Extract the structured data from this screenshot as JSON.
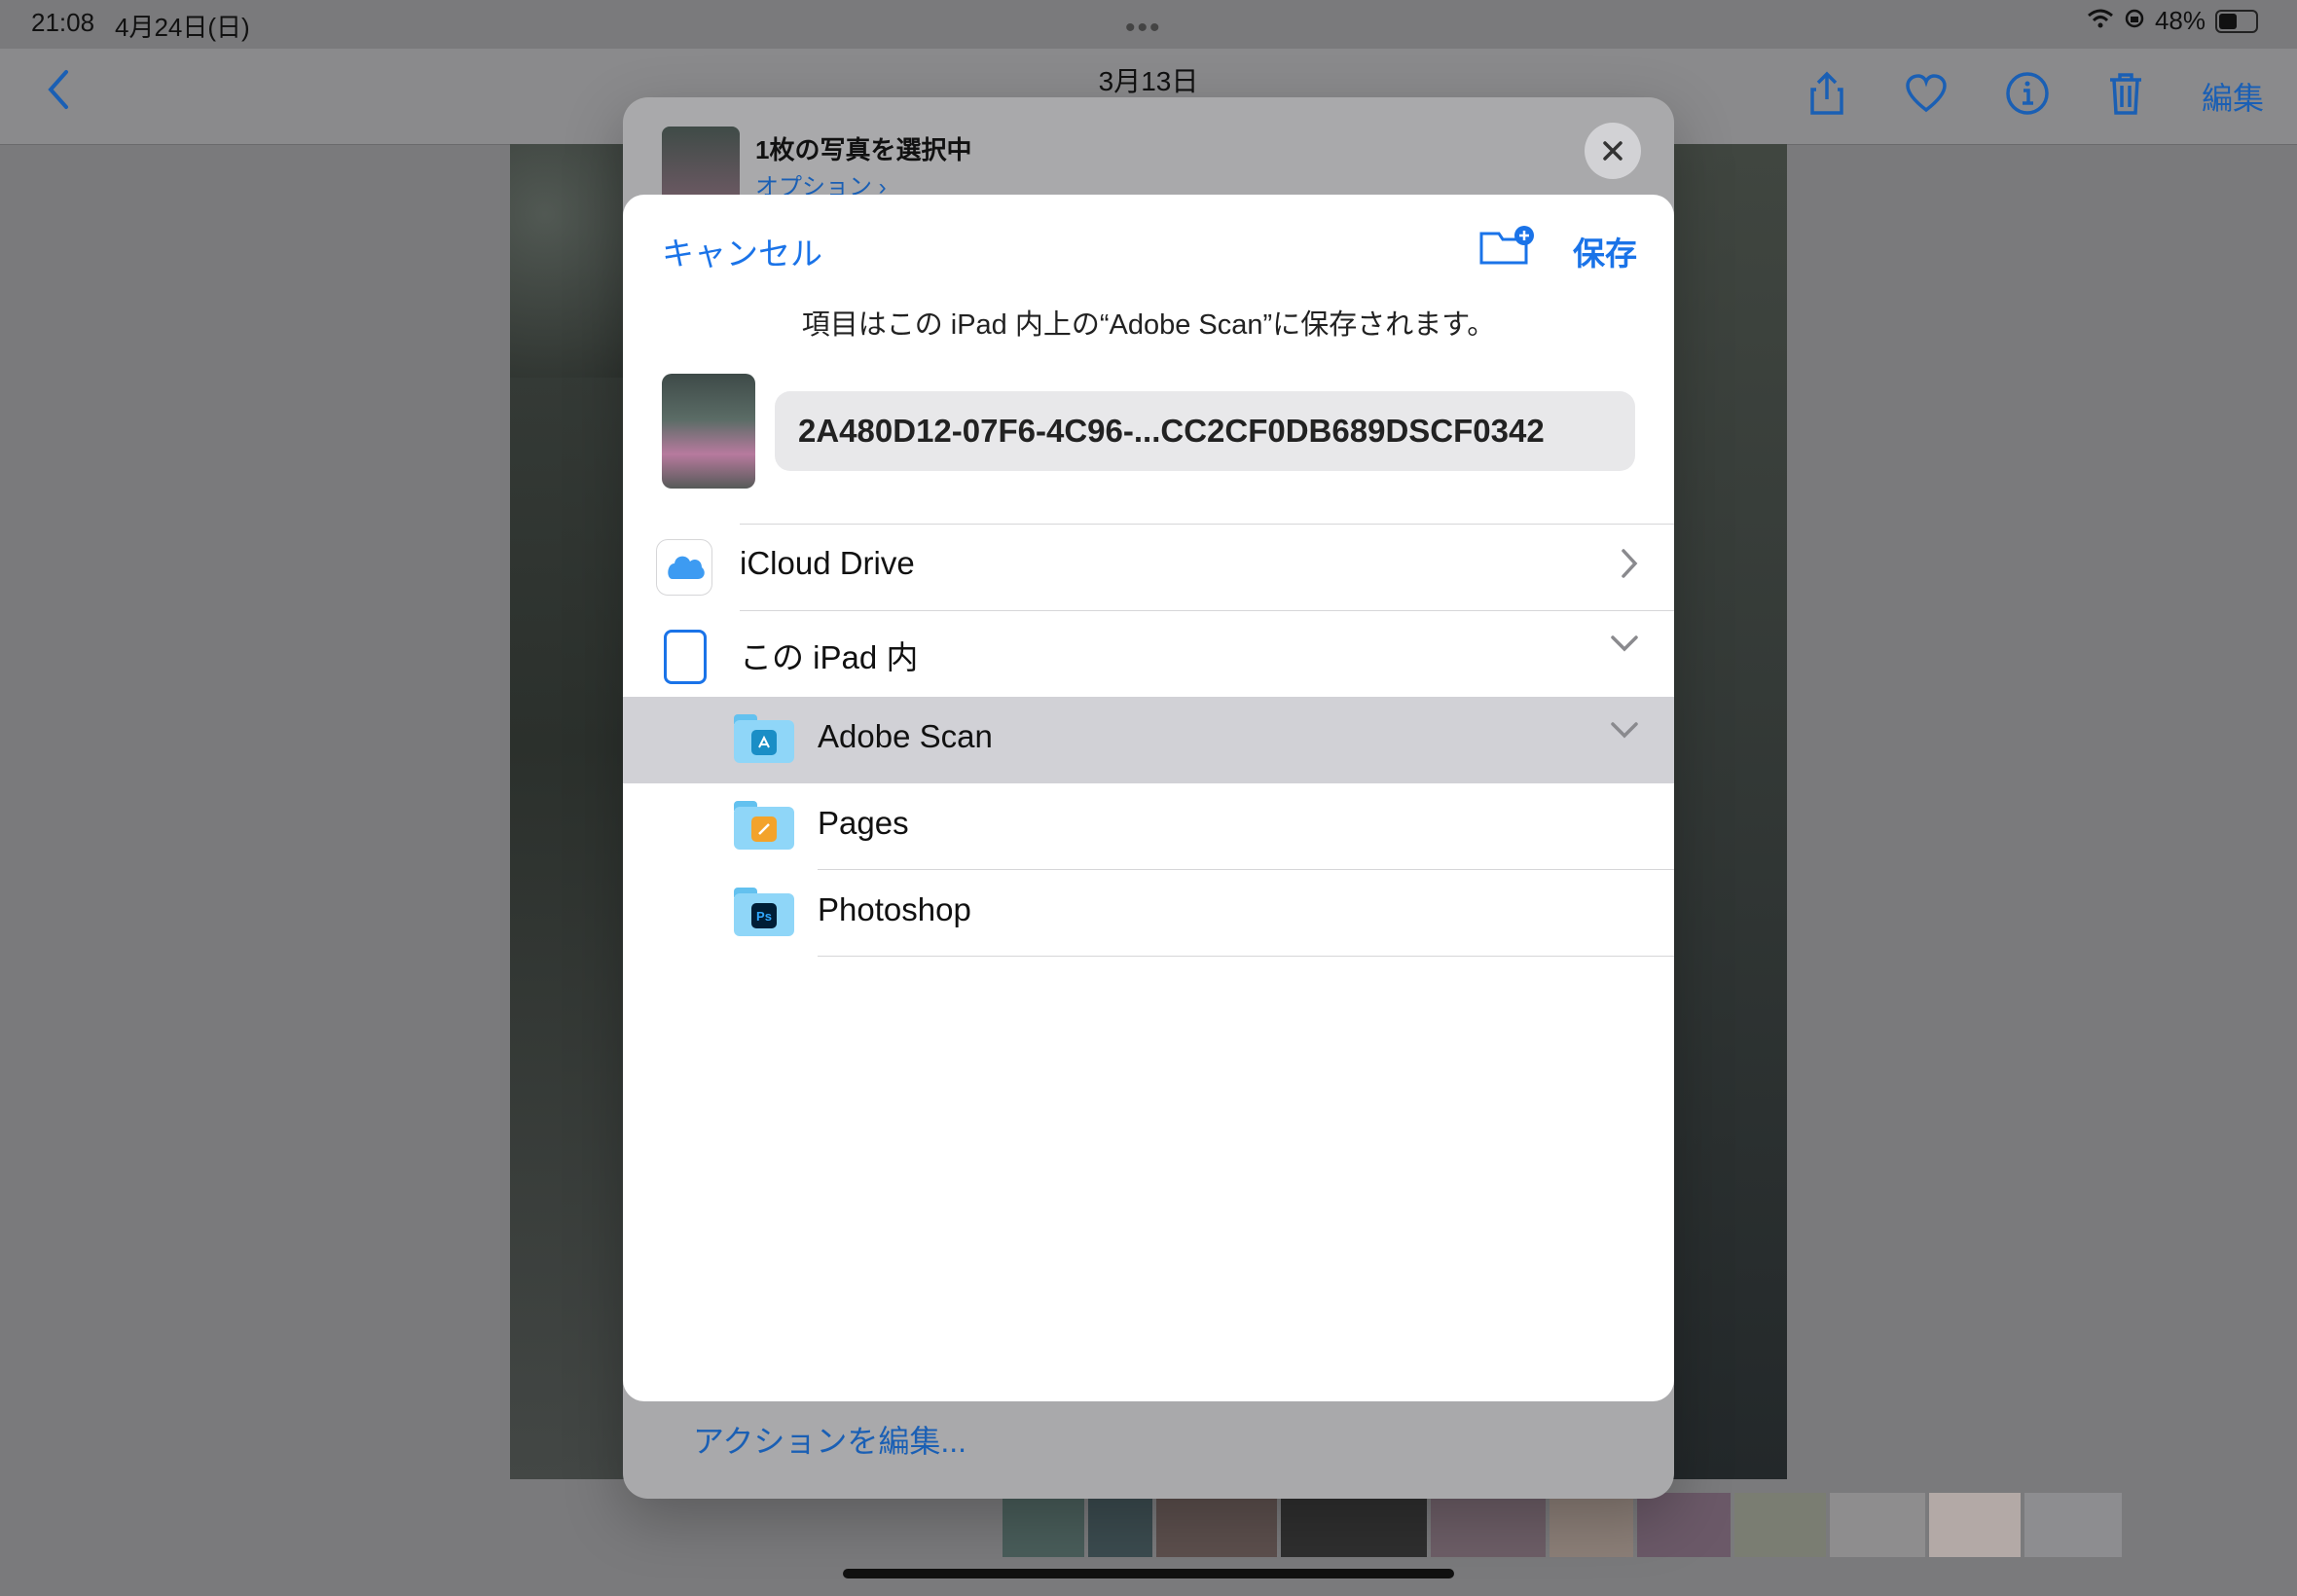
{
  "status_bar": {
    "time": "21:08",
    "date": "4月24日(日)",
    "battery": "48%",
    "dots": "•••"
  },
  "nav": {
    "title": "3月13日",
    "edit_label": "編集"
  },
  "share_sheet": {
    "title": "1枚の写真を選択中",
    "options_label": "オプション ›",
    "action_edit": "アクションを編集..."
  },
  "dialog": {
    "cancel": "キャンセル",
    "save": "保存",
    "message": "項目はこの iPad 内上の“Adobe Scan”に保存されます。",
    "filename": "2A480D12-07F6-4C96-...CC2CF0DB689DSCF0342",
    "locations": [
      {
        "label": "iCloud Drive"
      },
      {
        "label": "この iPad 内"
      },
      {
        "label": "Adobe Scan"
      },
      {
        "label": "Pages"
      },
      {
        "label": "Photoshop"
      }
    ]
  },
  "colors": {
    "accent": "#1a73e8",
    "selected_row": "#d1d1d6"
  },
  "icons": {
    "back": "chevron-left-icon",
    "share": "share-icon",
    "heart": "heart-icon",
    "info": "info-icon",
    "trash": "trash-icon",
    "close": "close-icon",
    "new_folder": "folder-plus-icon",
    "icloud": "cloud-icon",
    "ipad": "ipad-icon",
    "folder": "folder-icon"
  }
}
